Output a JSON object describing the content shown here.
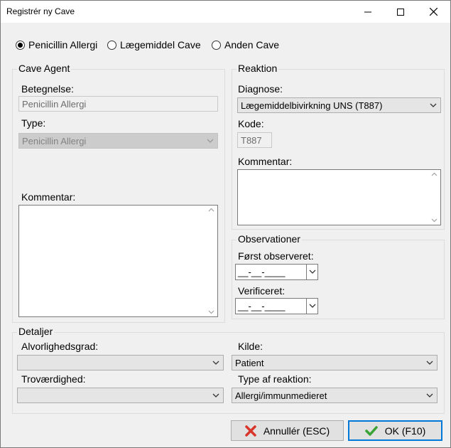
{
  "window": {
    "title": "Registrér ny Cave"
  },
  "cave_type": {
    "options": [
      "Penicillin Allergi",
      "Lægemiddel Cave",
      "Anden Cave"
    ],
    "selected_index": 0
  },
  "cave_agent": {
    "group_title": "Cave Agent",
    "betegnelse_label": "Betegnelse:",
    "betegnelse_value": "Penicillin Allergi",
    "type_label": "Type:",
    "type_value": "Penicillin Allergi",
    "kommentar_label": "Kommentar:"
  },
  "reaktion": {
    "group_title": "Reaktion",
    "diagnose_label": "Diagnose:",
    "diagnose_value": "Lægemiddelbivirkning UNS (T887)",
    "kode_label": "Kode:",
    "kode_value": "T887",
    "kommentar_label": "Kommentar:"
  },
  "observationer": {
    "group_title": "Observationer",
    "foerst_label": "Først observeret:",
    "foerst_value": "__-__-____",
    "verificeret_label": "Verificeret:",
    "verificeret_value": "__-__-____"
  },
  "detaljer": {
    "group_title": "Detaljer",
    "alvorlighed_label": "Alvorlighedsgrad:",
    "alvorlighed_value": "",
    "kilde_label": "Kilde:",
    "kilde_value": "Patient",
    "trovaerdighed_label": "Troværdighed:",
    "trovaerdighed_value": "",
    "type_reaktion_label": "Type af reaktion:",
    "type_reaktion_value": "Allergi/immunmedieret"
  },
  "buttons": {
    "cancel_label": "Annullér (ESC)",
    "ok_label": "OK (F10)"
  },
  "colors": {
    "cancel_icon": "#d9352b",
    "ok_icon": "#3aa335",
    "default_button_border": "#0078d7"
  }
}
